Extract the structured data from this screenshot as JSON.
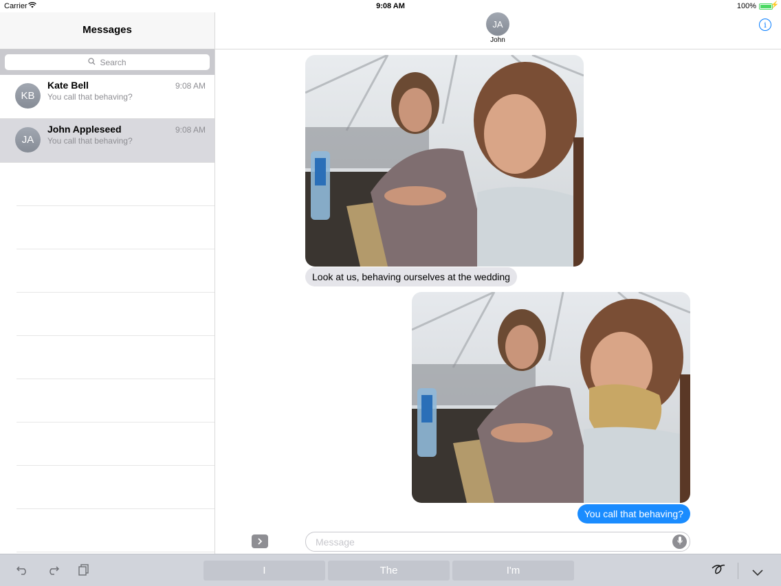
{
  "status": {
    "carrier": "Carrier",
    "time": "9:08 AM",
    "battery": "100%"
  },
  "sidebar": {
    "title": "Messages",
    "search_placeholder": "Search",
    "conversations": [
      {
        "initials": "KB",
        "name": "Kate Bell",
        "time": "9:08 AM",
        "preview": "You call that behaving?",
        "selected": false
      },
      {
        "initials": "JA",
        "name": "John Appleseed",
        "time": "9:08 AM",
        "preview": "You call that behaving?",
        "selected": true
      }
    ]
  },
  "chat": {
    "contact_initials": "JA",
    "contact_name": "John",
    "info_icon": "info-icon",
    "messages": [
      {
        "type": "photo",
        "direction": "incoming"
      },
      {
        "type": "text",
        "direction": "incoming",
        "text": "Look at us, behaving ourselves at the wedding"
      },
      {
        "type": "photo",
        "direction": "outgoing"
      },
      {
        "type": "text",
        "direction": "outgoing",
        "text": "You call that behaving?"
      }
    ],
    "input_placeholder": "Message",
    "input_value": ""
  },
  "keyboard": {
    "suggestions": [
      "I",
      "The",
      "I'm"
    ],
    "icons": [
      "undo-icon",
      "redo-icon",
      "paste-icon",
      "handwriting-icon",
      "dismiss-keyboard-icon"
    ]
  },
  "colors": {
    "accent": "#007aff",
    "outgoing_bubble": "#1a8cff",
    "incoming_bubble": "#e5e5ea"
  }
}
